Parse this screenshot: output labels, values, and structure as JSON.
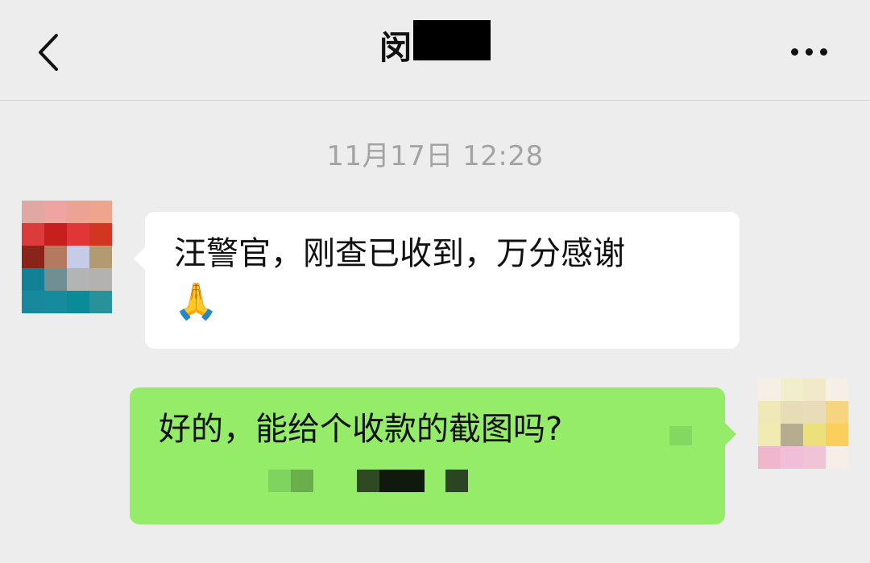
{
  "nav": {
    "back_icon": "chevron-left-icon",
    "title": "闵",
    "more_icon": "more-horizontal-icon"
  },
  "timestamp": "11月17日 12:28",
  "messages": [
    {
      "direction": "incoming",
      "text": "汪警官，刚查已收到，万分感谢",
      "emoji": "🙏",
      "avatar_colors": [
        "#e0a7a3",
        "#eea5a1",
        "#eda393",
        "#efa58d",
        "#dc3b3c",
        "#c71e1e",
        "#e03638",
        "#d23520",
        "#8a231a",
        "#b47a5f",
        "#c6cbe8",
        "#b29b70",
        "#128197",
        "#6f8f92",
        "#b2b5b3",
        "#b3b2ae",
        "#17889d",
        "#168b9d",
        "#0b8b97",
        "#28929a"
      ]
    },
    {
      "direction": "outgoing",
      "text": "好的，能给个收款的截图吗?",
      "bubble_color": "#95ec69",
      "avatar_colors": [
        "#f5efe6",
        "#f1eecc",
        "#f2e9cb",
        "#f5efe6",
        "#efe8b7",
        "#e6dcb6",
        "#e8dcb9",
        "#f5d580",
        "#f1ebb1",
        "#b6ad90",
        "#ebe07c",
        "#fbcf5e",
        "#efb6cc",
        "#f0bed8",
        "#f0c3d6",
        "#f6efe8"
      ]
    }
  ],
  "colors": {
    "background": "#ededed",
    "incoming_bubble": "#ffffff",
    "outgoing_bubble": "#95ec69",
    "timestamp_text": "#a3a3a3"
  }
}
